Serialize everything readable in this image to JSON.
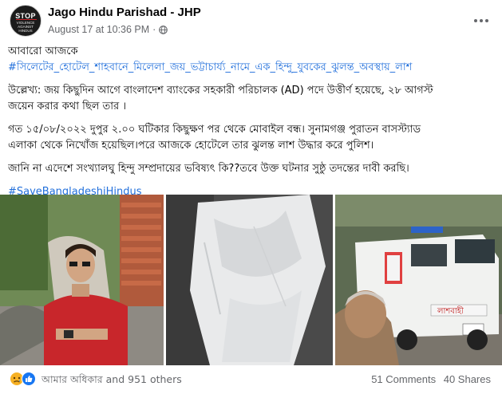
{
  "post": {
    "page_name": "Jago Hindu Parishad - JHP",
    "timestamp": "August 17 at 10:36 PM",
    "separator": "·",
    "avatar": {
      "title": "STOP",
      "subtitle": "VIOLENCE AGAINST HINDUS"
    }
  },
  "text": {
    "line1": "আবারো আজকে",
    "hashtag_main": "#সিলেটের_হোটেল_শাহবানে_মিলেলা_জয়_ভট্টাচার্য্য_নামে_এক_হিন্দু_যুবকের_ঝুলন্ত_অবস্থায়_লাশ",
    "para2_line1": "উল্লেখ্য: জয় কিছুদিন আগে বাংলাদেশ ব্যাংকের সহকারী পরিচালক (AD) পদে উত্তীর্ণ হয়েছে, ২৮ আগস্ট",
    "para2_line2": "জয়েন করার কথা ছিল তার ।",
    "para3_line1": "গত ১৫/০৮/২০২২ দুপুর ২.০০ ঘটিকার কিছুক্ষণ পর থেকে মোবাইল বন্ধ। সুনামগঞ্জ পুরাতন বাসস্ট্যাড",
    "para3_line2": "এলাকা থেকে নিখোঁজ হয়েছিল।পরে আজকে হোটেলে তার ঝুলন্ত লাশ উদ্ধার করে পুলিশ।",
    "para4": "জানি না এদেশে সংখ্যালঘু হিন্দু সম্প্রদায়ের ভবিষ্যৎ কি??তবে উক্ত ঘটনার সুষ্ঠু তদন্তের দাবী করছি।",
    "hashtag_footer": "#SaveBangladeshiHindus"
  },
  "photos": {
    "ambulance_text": "লাশবাহী"
  },
  "reactions": {
    "summary": "আমার অধিকার and 951 others",
    "comments": "51 Comments",
    "shares": "40 Shares"
  },
  "colors": {
    "link": "#216fdb",
    "secondary_text": "#65676b",
    "like_blue": "#1877f2",
    "sad_yellow": "#f7b125"
  }
}
